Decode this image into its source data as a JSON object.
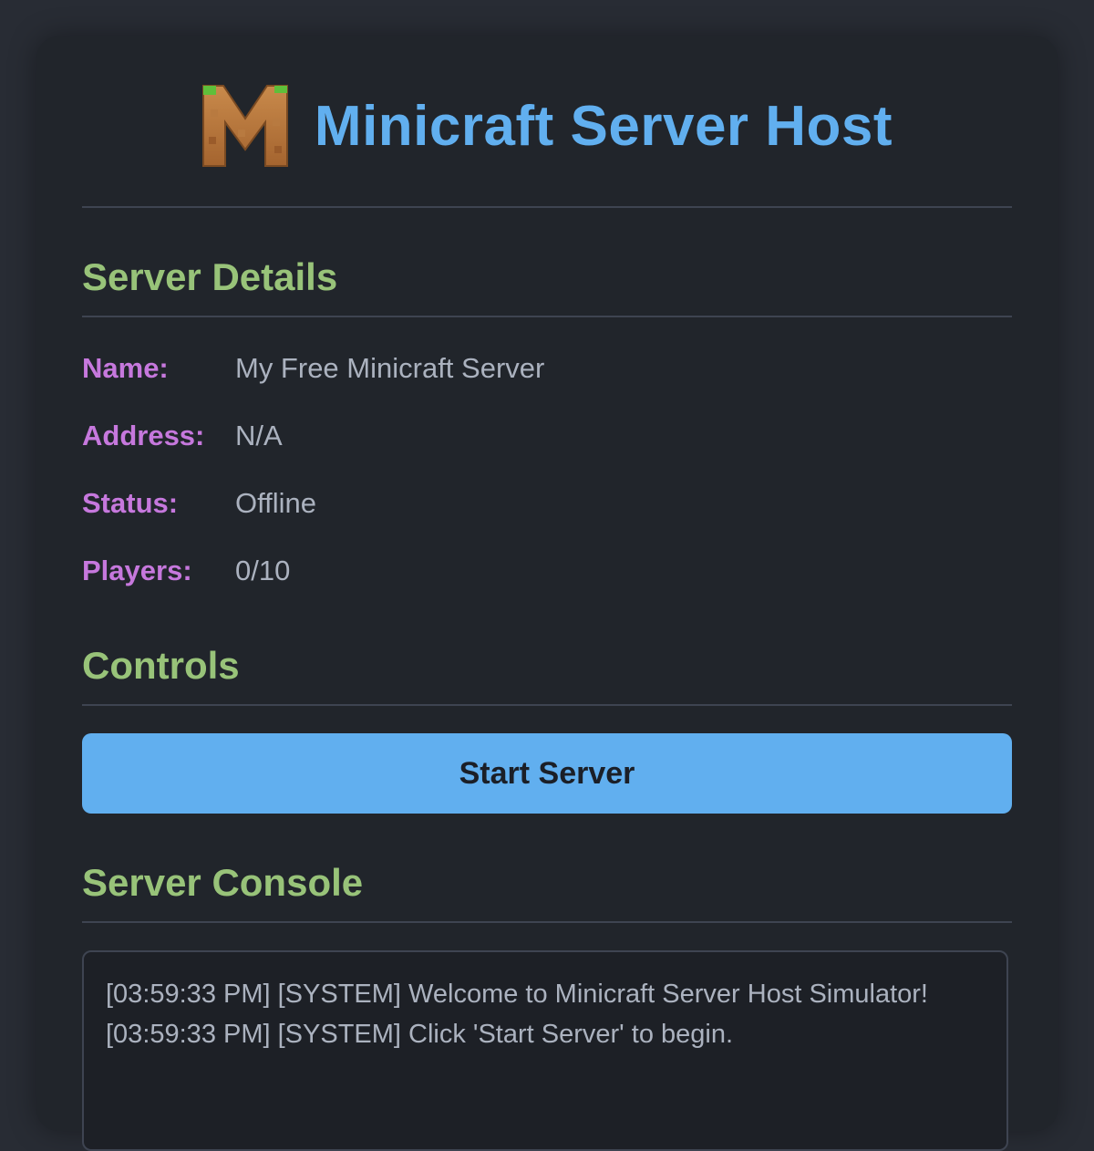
{
  "app": {
    "title": "Minicraft Server Host",
    "logo_icon": "minicraft-m-logo-icon"
  },
  "details": {
    "heading": "Server Details",
    "rows": [
      {
        "label": "Name:",
        "value": "My Free Minicraft Server"
      },
      {
        "label": "Address:",
        "value": "N/A"
      },
      {
        "label": "Status:",
        "value": "Offline"
      },
      {
        "label": "Players:",
        "value": "0/10"
      }
    ]
  },
  "controls": {
    "heading": "Controls",
    "start_label": "Start Server"
  },
  "console": {
    "heading": "Server Console",
    "lines": [
      "[03:59:33 PM] [SYSTEM] Welcome to Minicraft Server Host Simulator!",
      "[03:59:33 PM] [SYSTEM] Click 'Start Server' to begin."
    ]
  },
  "colors": {
    "page_bg": "#282c34",
    "card_bg": "#21252b",
    "title": "#61afef",
    "section_heading": "#98c379",
    "label": "#c678dd",
    "value_text": "#abb2bf",
    "button_bg": "#61afef",
    "divider": "#3e4451"
  }
}
